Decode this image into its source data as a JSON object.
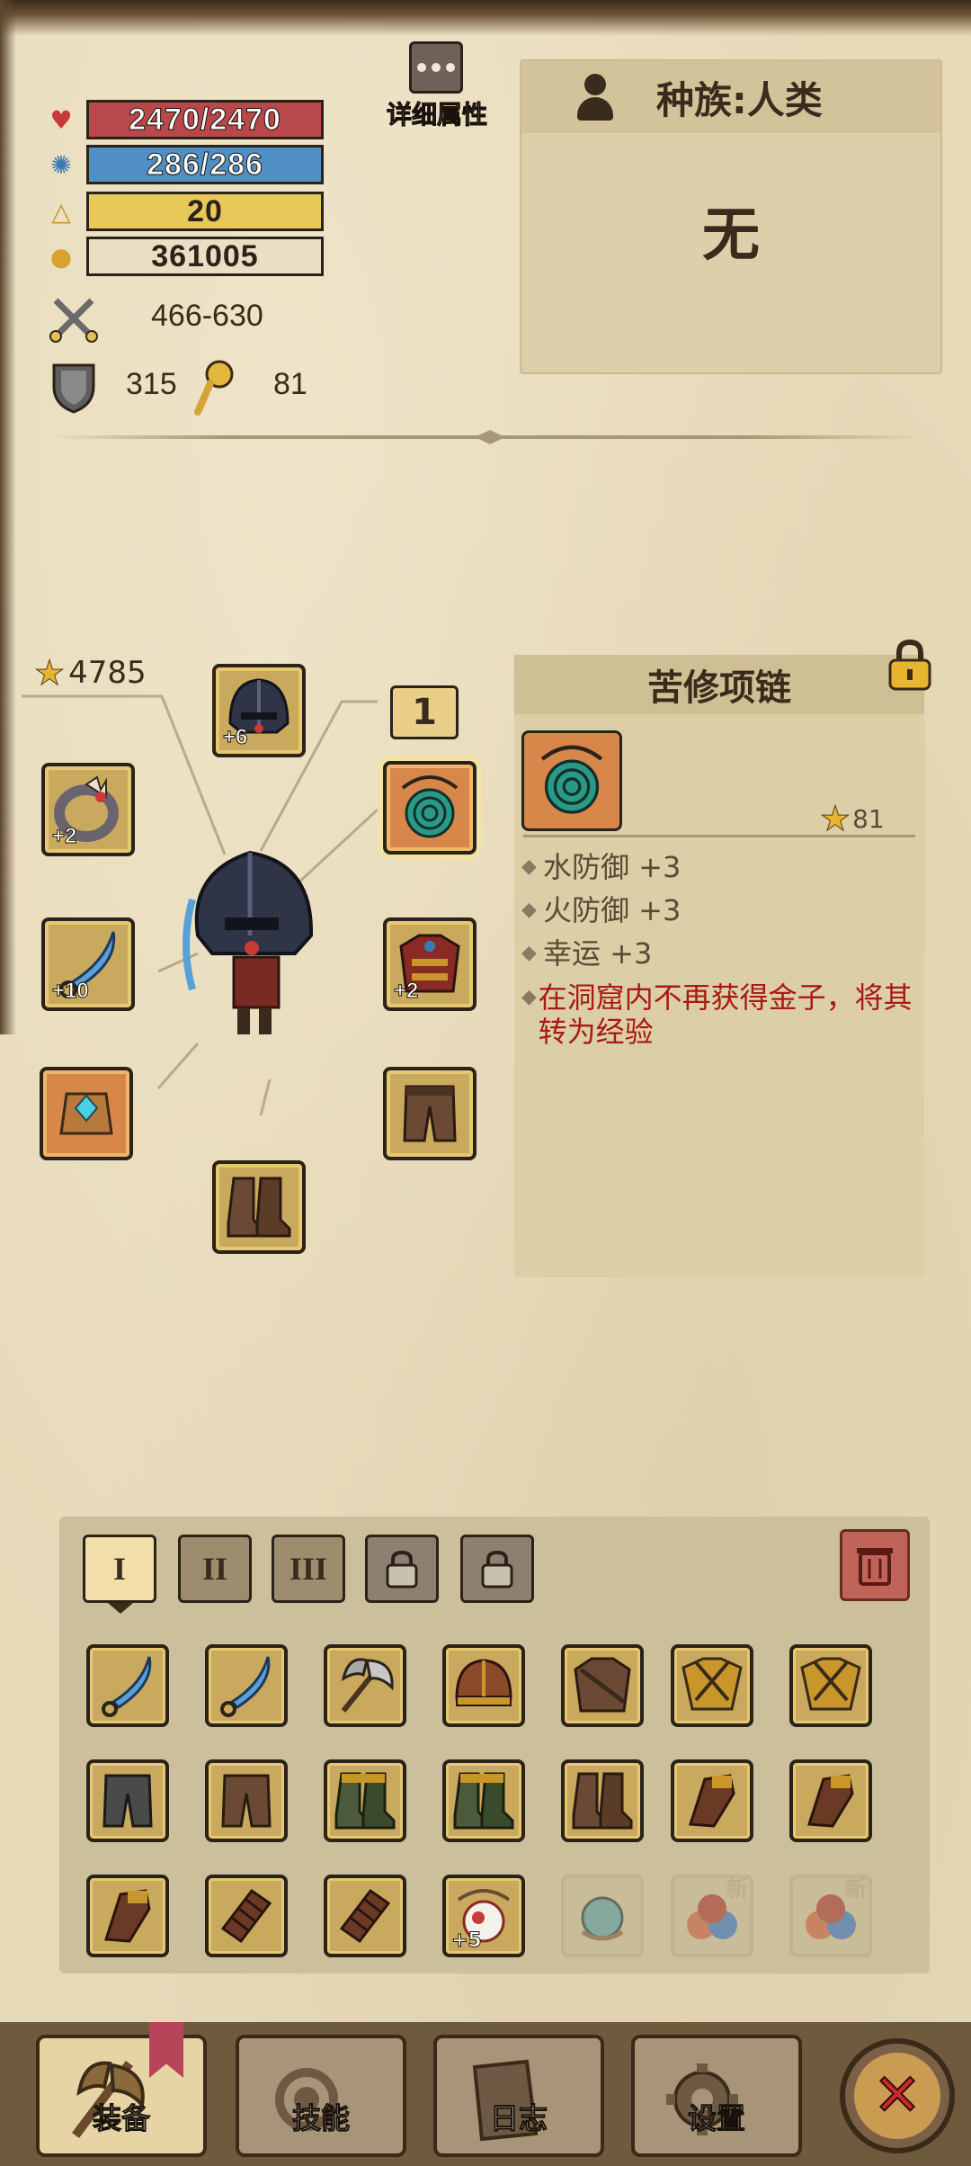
{
  "stats": {
    "hp": "2470/2470",
    "mp": "286/286",
    "level": "20",
    "gold": "361005",
    "attack": "466-630",
    "defense": "315",
    "magic": "81"
  },
  "detail_button_label": "详细属性",
  "race_panel": {
    "title": "种族:人类",
    "body": "无"
  },
  "equipment": {
    "star_total": "4785",
    "slot_number": "1",
    "helmet_plus": "+6",
    "ring_plus": "+2",
    "weapon_plus": "+10",
    "armor_plus": "+2"
  },
  "item_detail": {
    "name": "苦修项链",
    "star": "81",
    "attributes": [
      "水防御 +3",
      "火防御 +3",
      "幸运 +3"
    ],
    "special": "在洞窟内不再获得金子，将其转为经验"
  },
  "inventory": {
    "tabs": [
      "I",
      "II",
      "III"
    ],
    "new_badge": "新",
    "plus_badge": "+5"
  },
  "nav": {
    "equip": "装备",
    "skills": "技能",
    "log": "日志",
    "settings": "设置"
  },
  "colors": {
    "hp": "#b8484a",
    "mp": "#4f8fc4",
    "level": "#e8c85a",
    "accent_red": "#a81a14",
    "parchment": "#e6d9b8"
  }
}
